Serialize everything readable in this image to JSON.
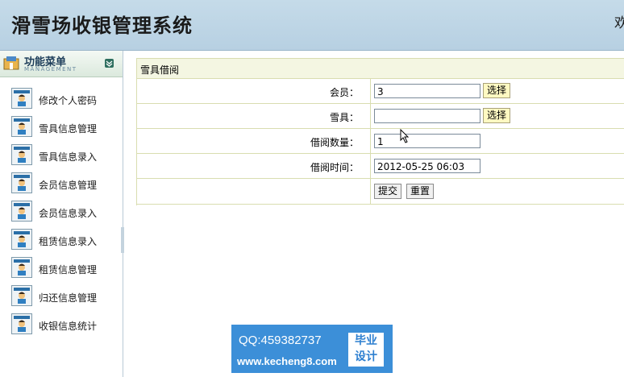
{
  "header": {
    "title": "滑雪场收银管理系统",
    "welcome": "欢"
  },
  "sidebar": {
    "title": "功能菜单",
    "subtitle": "MANAGEMENT",
    "items": [
      {
        "label": "修改个人密码",
        "icon": "user-icon"
      },
      {
        "label": "雪具信息管理",
        "icon": "user-icon"
      },
      {
        "label": "雪具信息录入",
        "icon": "user-icon"
      },
      {
        "label": "会员信息管理",
        "icon": "user-icon"
      },
      {
        "label": "会员信息录入",
        "icon": "user-icon"
      },
      {
        "label": "租赁信息录入",
        "icon": "user-icon"
      },
      {
        "label": "租赁信息管理",
        "icon": "user-icon"
      },
      {
        "label": "归还信息管理",
        "icon": "user-icon"
      },
      {
        "label": "收银信息统计",
        "icon": "user-icon"
      }
    ]
  },
  "form": {
    "title": "雪具借阅",
    "member_label": "会员：",
    "member_value": "3",
    "member_select": "选择",
    "gear_label": "雪具：",
    "gear_value": "",
    "gear_select": "选择",
    "qty_label": "借阅数量：",
    "qty_value": "1",
    "time_label": "借阅时间：",
    "time_value": "2012-05-25 06:03",
    "submit_label": "提交",
    "reset_label": "重置"
  },
  "watermark": {
    "qq": "QQ:459382737",
    "site": "www.kecheng8.com",
    "badge_line1": "毕业",
    "badge_line2": "设计"
  },
  "colors": {
    "header_bg": "#c5dbe9",
    "form_border": "#d9ddb0",
    "select_button": "#fff9c2",
    "watermark_bg": "#3c8fd8"
  }
}
